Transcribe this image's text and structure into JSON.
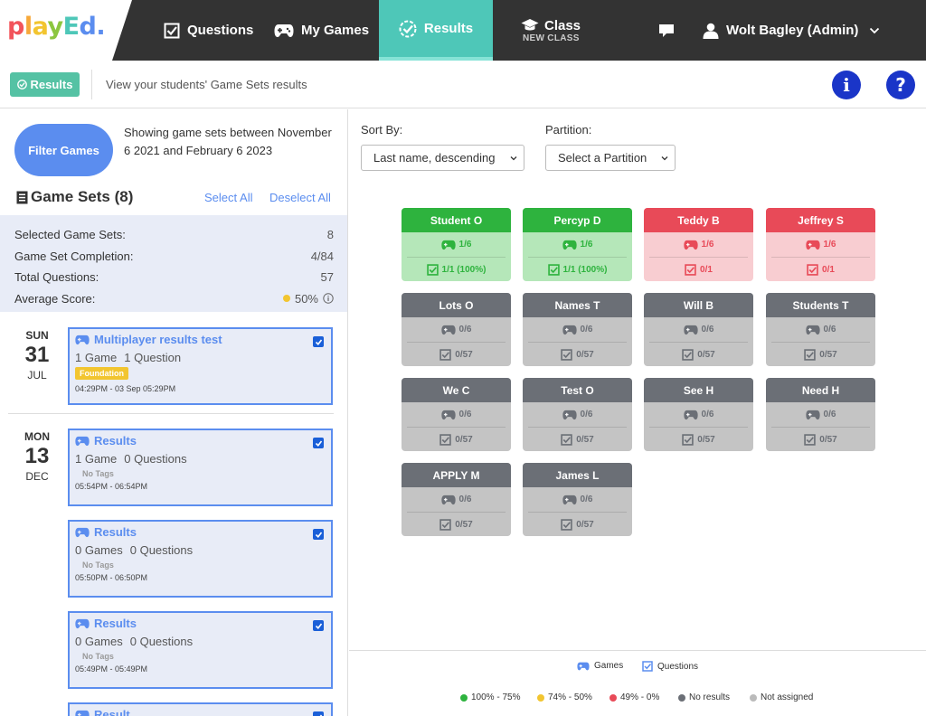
{
  "nav": {
    "logo": [
      "p",
      "l",
      "a",
      "y",
      "E",
      "d",
      "."
    ],
    "questions": "Questions",
    "my_games": "My Games",
    "results": "Results",
    "class": "Class",
    "class_sub": "NEW CLASS",
    "user": "Wolt Bagley (Admin)"
  },
  "subheader": {
    "results_button": "Results",
    "description": "View your students' Game Sets results",
    "info_label": "i",
    "help_label": "?"
  },
  "filter": {
    "button": "Filter Games",
    "showing": "Showing game sets between November 6 2021 and February 6 2023"
  },
  "game_sets": {
    "title": "Game Sets (8)",
    "select_all": "Select All",
    "deselect_all": "Deselect All"
  },
  "stats": {
    "selected_label": "Selected Game Sets:",
    "selected_value": "8",
    "completion_label": "Game Set Completion:",
    "completion_value": "4/84",
    "total_label": "Total Questions:",
    "total_value": "57",
    "average_label": "Average Score:",
    "average_value": "50%"
  },
  "days": [
    {
      "dow": "SUN",
      "num": "31",
      "mon": "JUL"
    },
    {
      "dow": "MON",
      "num": "13",
      "mon": "DEC"
    }
  ],
  "cards": [
    {
      "title": "Multiplayer results test",
      "games": "1 Game",
      "questions": "1 Question",
      "tag": "Foundation",
      "time": "04:29PM - 03 Sep 05:29PM"
    },
    {
      "title": "Results",
      "games": "1 Game",
      "questions": "0 Questions",
      "tag": "No Tags",
      "time": "05:54PM - 06:54PM"
    },
    {
      "title": "Results",
      "games": "0 Games",
      "questions": "0 Questions",
      "tag": "No Tags",
      "time": "05:50PM - 06:50PM"
    },
    {
      "title": "Results",
      "games": "0 Games",
      "questions": "0 Questions",
      "tag": "No Tags",
      "time": "05:49PM - 05:49PM"
    },
    {
      "title": "Result"
    }
  ],
  "controls": {
    "sort_label": "Sort By:",
    "sort_value": "Last name, descending",
    "partition_label": "Partition:",
    "partition_value": "Select a Partition"
  },
  "students": [
    {
      "name": "Student O",
      "games": "1/6",
      "questions": "1/1 (100%)",
      "status": "green"
    },
    {
      "name": "Percyp D",
      "games": "1/6",
      "questions": "1/1 (100%)",
      "status": "green"
    },
    {
      "name": "Teddy B",
      "games": "1/6",
      "questions": "0/1",
      "status": "red"
    },
    {
      "name": "Jeffrey S",
      "games": "1/6",
      "questions": "0/1",
      "status": "red"
    },
    {
      "name": "Lots O",
      "games": "0/6",
      "questions": "0/57",
      "status": "grey"
    },
    {
      "name": "Names T",
      "games": "0/6",
      "questions": "0/57",
      "status": "grey"
    },
    {
      "name": "Will B",
      "games": "0/6",
      "questions": "0/57",
      "status": "grey"
    },
    {
      "name": "Students T",
      "games": "0/6",
      "questions": "0/57",
      "status": "grey"
    },
    {
      "name": "We C",
      "games": "0/6",
      "questions": "0/57",
      "status": "grey"
    },
    {
      "name": "Test O",
      "games": "0/6",
      "questions": "0/57",
      "status": "grey"
    },
    {
      "name": "See H",
      "games": "0/6",
      "questions": "0/57",
      "status": "grey"
    },
    {
      "name": "Need H",
      "games": "0/6",
      "questions": "0/57",
      "status": "grey"
    },
    {
      "name": "APPLY M",
      "games": "0/6",
      "questions": "0/57",
      "status": "grey"
    },
    {
      "name": "James L",
      "games": "0/6",
      "questions": "0/57",
      "status": "grey"
    }
  ],
  "legend": {
    "games": "Games",
    "questions": "Questions",
    "high": "100% - 75%",
    "mid": "74% - 50%",
    "low": "49% - 0%",
    "none": "No results",
    "unassigned": "Not assigned"
  },
  "colors": {
    "nav_bg": "#333333",
    "results_tab": "#4ec7b8",
    "primary": "#5b8def",
    "green": "#2eb33e",
    "yellow": "#f2c530",
    "red": "#e84a58",
    "grey": "#6b6f76",
    "light_grey": "#bbbbbb"
  }
}
